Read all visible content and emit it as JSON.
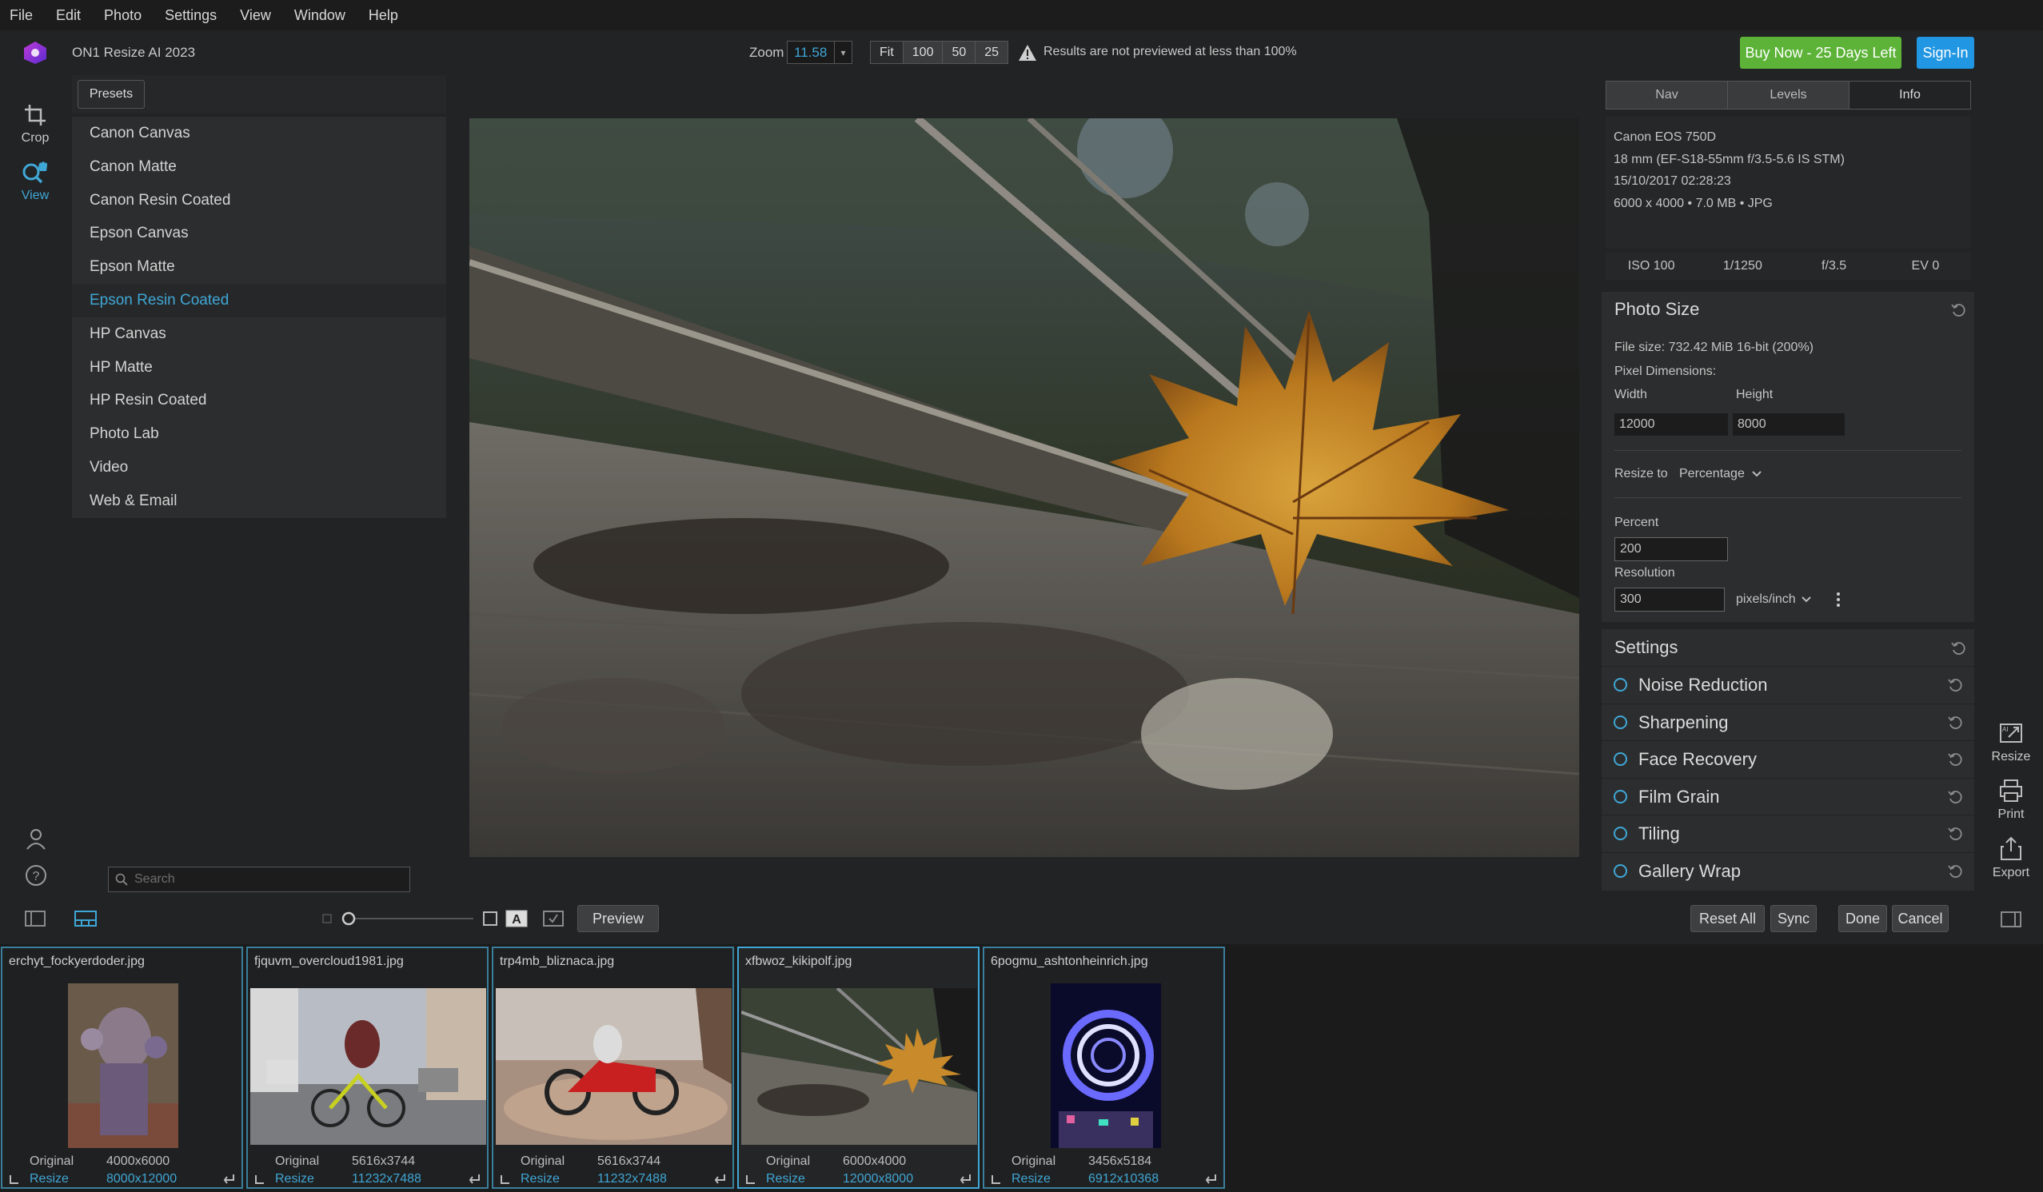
{
  "menu": [
    "File",
    "Edit",
    "Photo",
    "Settings",
    "View",
    "Window",
    "Help"
  ],
  "app": {
    "title": "ON1 Resize AI 2023",
    "accent": "#3fa7d6"
  },
  "zoom": {
    "label": "Zoom",
    "value": "11.58",
    "buttons": [
      "Fit",
      "100",
      "50",
      "25"
    ],
    "warning": "Results are not previewed at less than 100%"
  },
  "header_buttons": {
    "buy": "Buy Now - 25 Days Left",
    "sign_in": "Sign-In",
    "buy_color": "#5cb338",
    "sign_in_color": "#2196e3"
  },
  "tools": {
    "crop": "Crop",
    "view": "View"
  },
  "presets": {
    "button": "Presets",
    "items": [
      "Canon Canvas",
      "Canon Matte",
      "Canon Resin Coated",
      "Epson Canvas",
      "Epson Matte",
      "Epson Resin Coated",
      "HP Canvas",
      "HP Matte",
      "HP Resin Coated",
      "Photo Lab",
      "Video",
      "Web & Email"
    ],
    "selected_index": 5
  },
  "search": {
    "placeholder": "Search"
  },
  "right_tabs": [
    "Nav",
    "Levels",
    "Info"
  ],
  "info": {
    "camera": "Canon EOS 750D",
    "lens": "18 mm (EF-S18-55mm f/3.5-5.6 IS STM)",
    "date": "15/10/2017 02:28:23",
    "dims": "6000 x 4000  •  7.0 MB  •  JPG",
    "exif": [
      "ISO 100",
      "1/1250",
      "f/3.5",
      "EV 0"
    ]
  },
  "photo_size": {
    "title": "Photo Size",
    "file_size": "File size: 732.42 MiB 16-bit (200%)",
    "pixel_dimensions": "Pixel Dimensions:",
    "width_label": "Width",
    "height_label": "Height",
    "width": "12000",
    "height": "8000",
    "resize_to_label": "Resize to",
    "resize_to": "Percentage",
    "percent_label": "Percent",
    "percent": "200",
    "resolution_label": "Resolution",
    "resolution": "300",
    "resolution_unit": "pixels/inch"
  },
  "settings": {
    "title": "Settings",
    "items": [
      "Noise Reduction",
      "Sharpening",
      "Face Recovery",
      "Film Grain",
      "Tiling",
      "Gallery Wrap"
    ]
  },
  "right_tools": [
    "Resize",
    "Print",
    "Export"
  ],
  "bottom": {
    "preview": "Preview",
    "reset_all": "Reset All",
    "sync": "Sync",
    "done": "Done",
    "cancel": "Cancel"
  },
  "filmstrip": [
    {
      "name": "erchyt_fockyerdoder.jpg",
      "original_label": "Original",
      "original": "4000x6000",
      "resize_label": "Resize",
      "resized": "8000x12000"
    },
    {
      "name": "fjquvm_overcloud1981.jpg",
      "original_label": "Original",
      "original": "5616x3744",
      "resize_label": "Resize",
      "resized": "11232x7488"
    },
    {
      "name": "trp4mb_bliznaca.jpg",
      "original_label": "Original",
      "original": "5616x3744",
      "resize_label": "Resize",
      "resized": "11232x7488"
    },
    {
      "name": "xfbwoz_kikipolf.jpg",
      "original_label": "Original",
      "original": "6000x4000",
      "resize_label": "Resize",
      "resized": "12000x8000"
    },
    {
      "name": "6pogmu_ashtonheinrich.jpg",
      "original_label": "Original",
      "original": "3456x5184",
      "resize_label": "Resize",
      "resized": "6912x10368"
    }
  ]
}
